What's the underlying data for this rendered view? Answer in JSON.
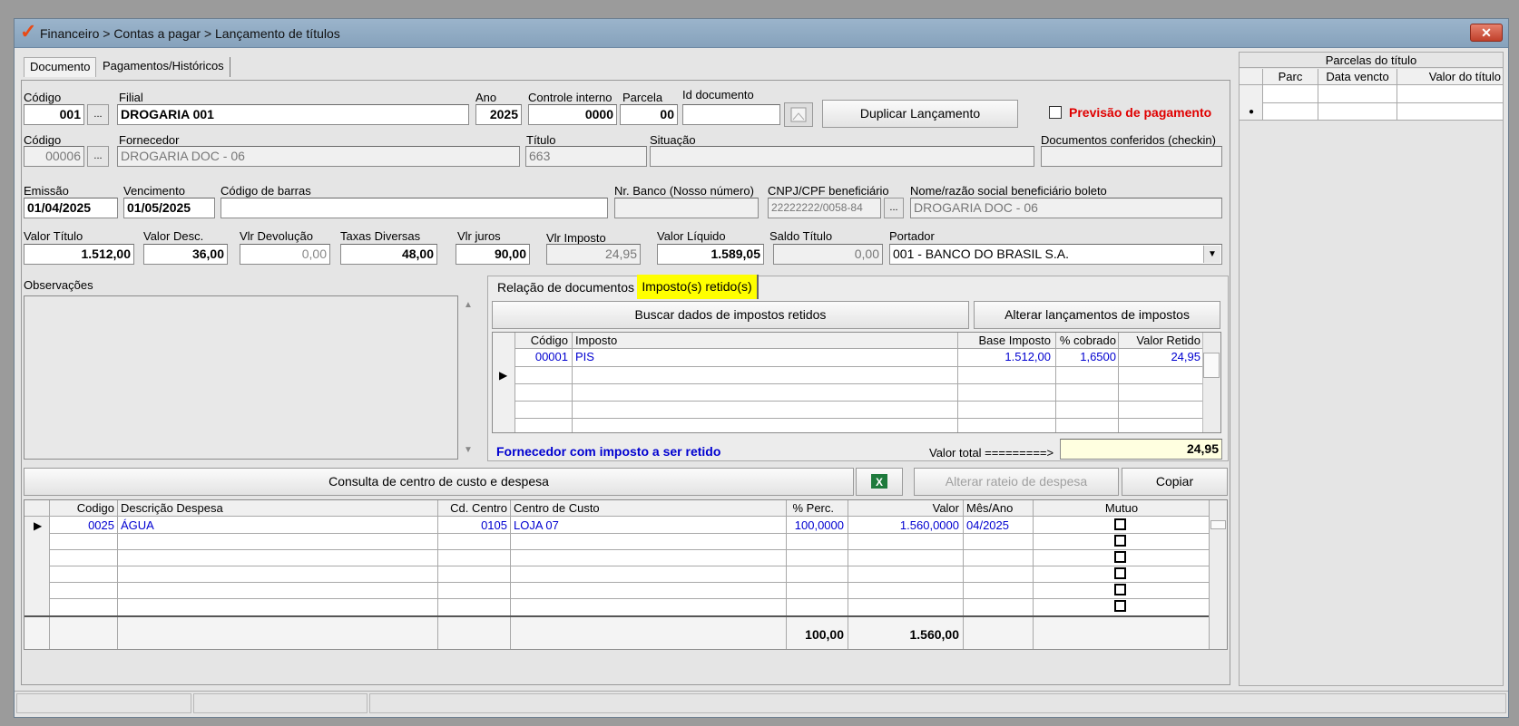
{
  "window": {
    "title": "Financeiro > Contas a pagar > Lançamento de títulos",
    "close_label": "✕",
    "logo": "✓"
  },
  "tabs": [
    {
      "label": "Documento"
    },
    {
      "label": "Pagamentos/Históricos"
    }
  ],
  "row1": {
    "codigo_label": "Código",
    "codigo_value": "001",
    "filial_label": "Filial",
    "filial_value": "DROGARIA 001",
    "ano_label": "Ano",
    "ano_value": "2025",
    "controle_label": "Controle interno",
    "controle_value": "0000",
    "parcela_label": "Parcela",
    "parcela_value": "00",
    "iddoc_label": "Id documento",
    "iddoc_value": "",
    "duplicar_label": "Duplicar Lançamento",
    "previsao_label": "Previsão de pagamento"
  },
  "row2": {
    "codigo_label": "Código",
    "codigo_value": "00006",
    "fornecedor_label": "Fornecedor",
    "fornecedor_value": "DROGARIA DOC - 06",
    "titulo_label": "Título",
    "titulo_value": "663",
    "situacao_label": "Situação",
    "situacao_value": "",
    "docs_label": "Documentos conferidos (checkin)",
    "docs_value": ""
  },
  "row3": {
    "emissao_label": "Emissão",
    "emissao_value": "01/04/2025",
    "vencimento_label": "Vencimento",
    "vencimento_value": "01/05/2025",
    "barras_label": "Código de barras",
    "barras_value": "",
    "nrbanco_label": "Nr. Banco (Nosso número)",
    "nrbanco_value": "",
    "cnpj_label": "CNPJ/CPF beneficiário",
    "cnpj_value": "22222222/0058-84",
    "nome_label": "Nome/razão social beneficiário boleto",
    "nome_value": "DROGARIA DOC - 06"
  },
  "row4": {
    "valor_titulo_label": "Valor Título",
    "valor_titulo_value": "1.512,00",
    "valor_desc_label": "Valor Desc.",
    "valor_desc_value": "36,00",
    "vlr_devolucao_label": "Vlr Devolução",
    "vlr_devolucao_value": "0,00",
    "taxas_label": "Taxas Diversas",
    "taxas_value": "48,00",
    "juros_label": "Vlr juros",
    "juros_value": "90,00",
    "imposto_label": "Vlr Imposto",
    "imposto_value": "24,95",
    "liquido_label": "Valor Líquido",
    "liquido_value": "1.589,05",
    "saldo_label": "Saldo Título",
    "saldo_value": "0,00",
    "portador_label": "Portador",
    "portador_value": "001 - BANCO DO BRASIL S.A."
  },
  "observacoes_label": "Observações",
  "inner_tabs": [
    {
      "label": "Relação de documentos"
    },
    {
      "label": "Imposto(s) retido(s)"
    }
  ],
  "impostos": {
    "buscar_label": "Buscar dados de impostos retidos",
    "alterar_label": "Alterar lançamentos de impostos",
    "headers": [
      "Código",
      "Imposto",
      "Base Imposto",
      "% cobrado",
      "Valor Retido"
    ],
    "rows": [
      {
        "codigo": "00001",
        "imposto": "PIS",
        "base": "1.512,00",
        "cobrado": "1,6500",
        "retido": "24,95"
      }
    ],
    "fornecedor_msg": "Fornecedor com imposto a ser retido",
    "valor_total_label": "Valor total =========>",
    "valor_total_value": "24,95"
  },
  "centro": {
    "consulta_label": "Consulta de centro de custo e despesa",
    "alterar_rateio_label": "Alterar rateio de despesa",
    "copiar_label": "Copiar",
    "headers": [
      "Codigo",
      "Descrição Despesa",
      "Cd. Centro",
      "Centro de Custo",
      "% Perc.",
      "Valor",
      "Mês/Ano",
      "Mutuo"
    ],
    "rows": [
      {
        "codigo": "0025",
        "descricao": "ÁGUA",
        "cd_centro": "0105",
        "centro": "LOJA 07",
        "perc": "100,0000",
        "valor": "1.560,0000",
        "mes": "04/2025"
      }
    ],
    "total_perc": "100,00",
    "total_valor": "1.560,00"
  },
  "parcelas": {
    "title": "Parcelas do título",
    "headers": [
      "Parc",
      "Data vencto",
      "Valor do título"
    ]
  },
  "colors": {
    "highlight": "#ffff00",
    "previsao": "#e00000",
    "blue_text": "#0000d0"
  }
}
